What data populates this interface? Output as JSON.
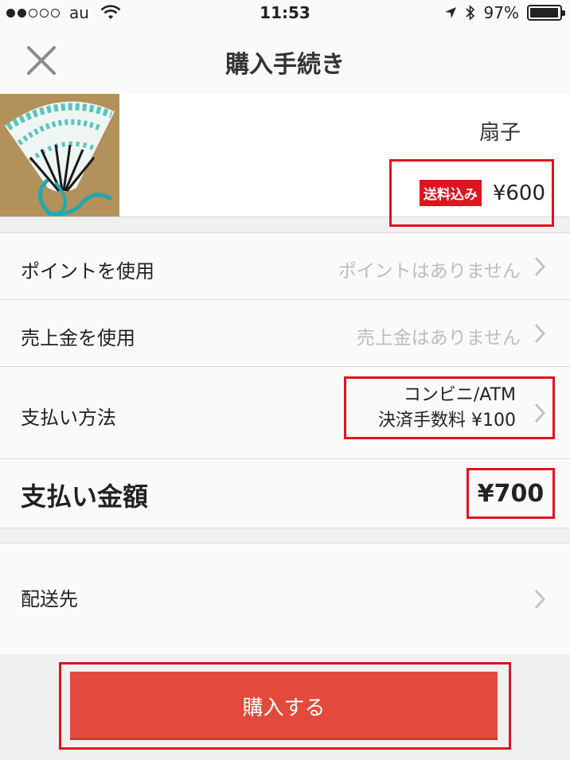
{
  "status_bar": {
    "carrier": "au",
    "signal_bars": 2,
    "time": "11:53",
    "battery_percent": "97%",
    "battery_level": 0.97,
    "icons": [
      "wifi-icon",
      "location-arrow-icon",
      "bluetooth-icon",
      "battery-icon"
    ]
  },
  "nav": {
    "title": "購入手続き",
    "close_icon": "close-icon"
  },
  "product": {
    "name": "扇子",
    "shipping_badge": "送料込み",
    "price": "¥600"
  },
  "options": {
    "points": {
      "label": "ポイントを使用",
      "value": "ポイントはありません"
    },
    "sales": {
      "label": "売上金を使用",
      "value": "売上金はありません"
    },
    "payment": {
      "label": "支払い方法",
      "method": "コンビニ/ATM",
      "fee": "決済手数料 ¥100"
    },
    "total": {
      "label": "支払い金額",
      "amount": "¥700"
    }
  },
  "shipping": {
    "label": "配送先"
  },
  "buy_button": {
    "label": "購入する"
  },
  "colors": {
    "accent_red": "#e0141e",
    "button_red": "#e34a3c",
    "muted_text": "#bdbdbd"
  }
}
